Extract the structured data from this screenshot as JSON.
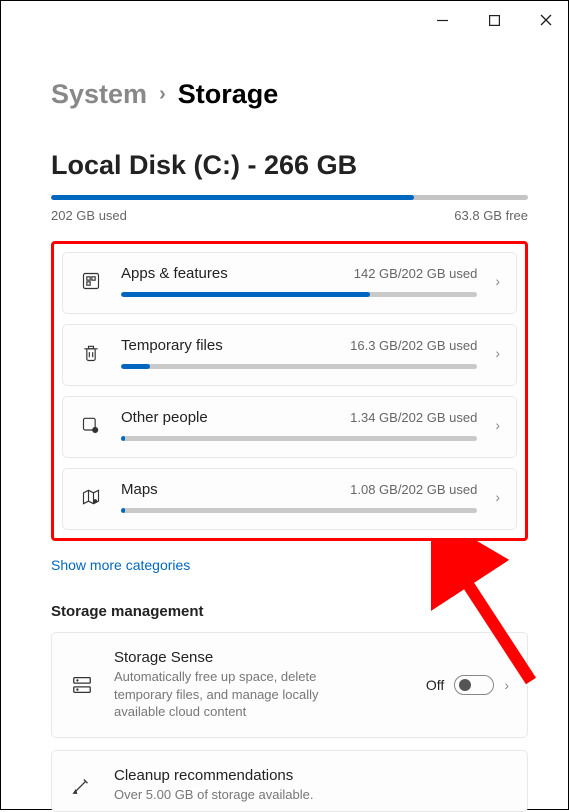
{
  "breadcrumb": {
    "parent": "System",
    "current": "Storage"
  },
  "disk": {
    "title": "Local Disk (C:) - 266 GB",
    "used_label": "202 GB used",
    "free_label": "63.8 GB free",
    "fill_pct": 76
  },
  "categories": [
    {
      "name": "Apps & features",
      "usage": "142 GB/202 GB used",
      "fill_pct": 70,
      "icon": "apps"
    },
    {
      "name": "Temporary files",
      "usage": "16.3 GB/202 GB used",
      "fill_pct": 8,
      "icon": "trash"
    },
    {
      "name": "Other people",
      "usage": "1.34 GB/202 GB used",
      "fill_pct": 1,
      "icon": "people"
    },
    {
      "name": "Maps",
      "usage": "1.08 GB/202 GB used",
      "fill_pct": 1,
      "icon": "maps"
    }
  ],
  "show_more": "Show more categories",
  "management_section": "Storage management",
  "storage_sense": {
    "title": "Storage Sense",
    "desc": "Automatically free up space, delete temporary files, and manage locally available cloud content",
    "toggle_label": "Off"
  },
  "cleanup": {
    "title": "Cleanup recommendations",
    "desc": "Over 5.00 GB of storage available."
  }
}
